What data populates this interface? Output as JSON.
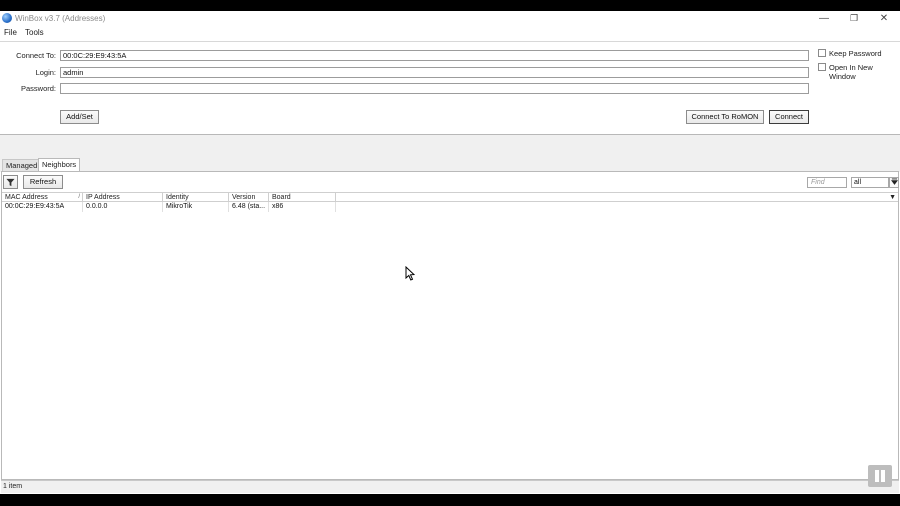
{
  "window": {
    "title": "WinBox v3.7 (Addresses)",
    "minimize_glyph": "—",
    "restore_glyph": "❐",
    "close_glyph": "✕"
  },
  "menu": {
    "items": [
      {
        "label": "File"
      },
      {
        "label": "Tools"
      }
    ]
  },
  "form": {
    "connect_to_label": "Connect To:",
    "connect_to_value": "00:0C:29:E9:43:5A",
    "login_label": "Login:",
    "login_value": "admin",
    "password_label": "Password:",
    "password_value": "",
    "keep_password_label": "Keep Password",
    "keep_password_checked": false,
    "open_new_window_label": "Open In New Window",
    "open_new_window_checked": false,
    "add_set_label": "Add/Set",
    "connect_romon_label": "Connect To RoMON",
    "connect_label": "Connect"
  },
  "tabs": [
    {
      "label": "Managed",
      "active": false
    },
    {
      "label": "Neighbors",
      "active": true
    }
  ],
  "toolbar": {
    "filter_icon": "filter-icon",
    "refresh_label": "Refresh",
    "find_placeholder": "Find",
    "filter_select_value": "all",
    "filter_arrow": "▼"
  },
  "table": {
    "columns": [
      {
        "label": "MAC Address",
        "sorted": true
      },
      {
        "label": "IP Address"
      },
      {
        "label": "Identity"
      },
      {
        "label": "Version"
      },
      {
        "label": "Board"
      }
    ],
    "rows": [
      [
        "00:0C:29:E9:43:5A",
        "0.0.0.0",
        "MikroTik",
        "6.48 (sta...",
        "x86"
      ]
    ],
    "header_dropdown": "▼",
    "sort_glyph": "/"
  },
  "status": {
    "item_count": "1 item"
  }
}
